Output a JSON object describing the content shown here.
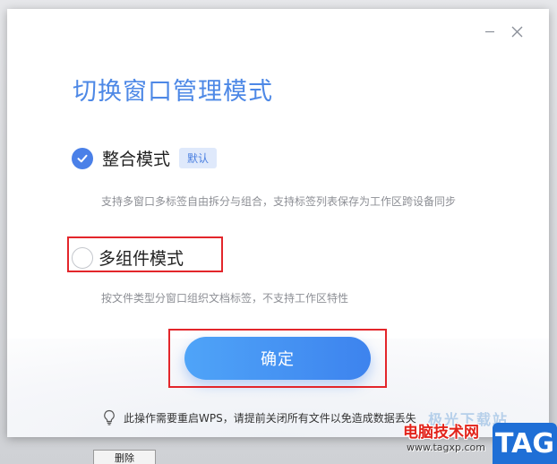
{
  "dialog": {
    "title": "切换窗口管理模式",
    "options": [
      {
        "label": "整合模式",
        "badge": "默认",
        "selected": true,
        "description": "支持多窗口多标签自由拆分与组合，支持标签列表保存为工作区跨设备同步"
      },
      {
        "label": "多组件模式",
        "selected": false,
        "description": "按文件类型分窗口组织文档标签，不支持工作区特性"
      }
    ],
    "confirm_label": "确定",
    "notice": "此操作需要重启WPS，请提前关闭所有文件以免造成数据丢失",
    "window_buttons": {
      "minimize_icon": "minimize-icon",
      "close_icon": "close-icon"
    }
  },
  "underlay": {
    "tab_label": "删除"
  },
  "watermark": {
    "line1": "电脑技术网",
    "line2": "www.tagxp.com",
    "logo": "TAG",
    "faded": "极光下载站"
  },
  "colors": {
    "accent": "#4d88e6",
    "button_start": "#4fa4f8",
    "button_end": "#3d83ee",
    "annotation_red": "#e3262b"
  }
}
